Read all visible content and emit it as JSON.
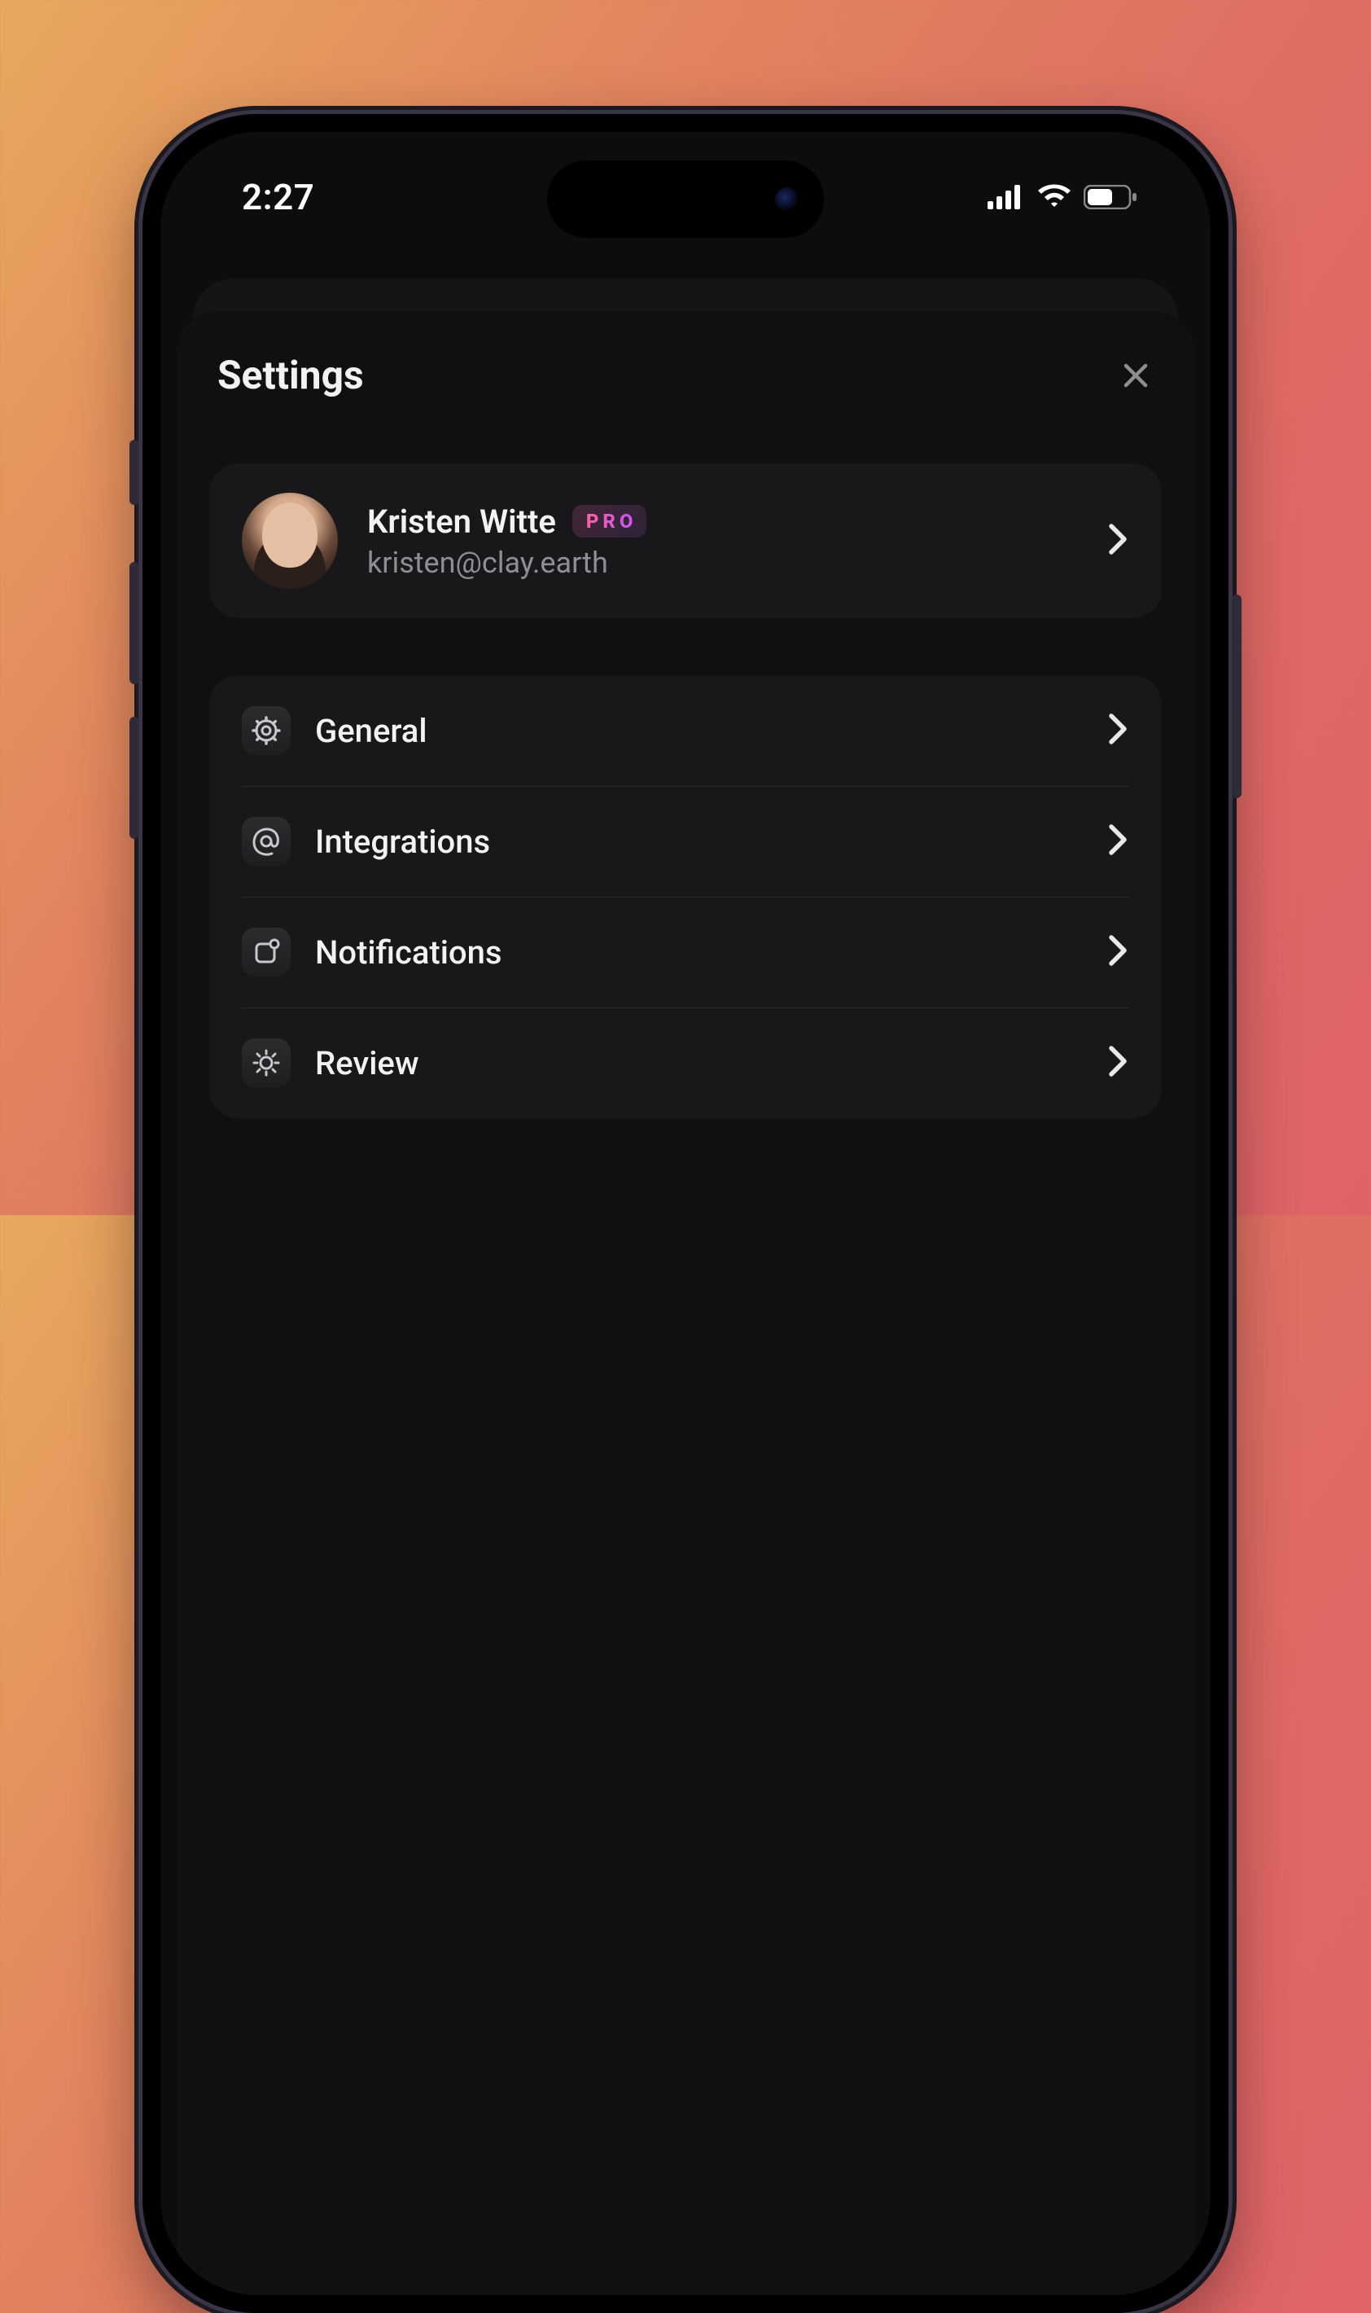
{
  "status": {
    "time": "2:27"
  },
  "header": {
    "title": "Settings"
  },
  "profile": {
    "name": "Kristen Witte",
    "badge": "PRO",
    "email": "kristen@clay.earth"
  },
  "rows": {
    "general": "General",
    "integrations": "Integrations",
    "notifications": "Notifications",
    "review": "Review"
  }
}
